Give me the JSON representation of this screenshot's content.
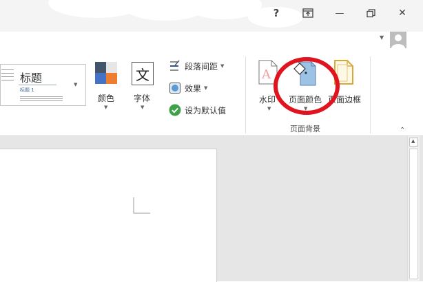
{
  "window": {
    "help_label": "?",
    "ribbon_display_label": "",
    "minimize_label": "—",
    "restore_label": "",
    "close_label": "✕"
  },
  "ribbon": {
    "style_thumbnail": {
      "title": "标题",
      "heading1": "标题 1"
    },
    "colors_label": "颜色",
    "fonts_label": "字体",
    "fonts_glyph": "文",
    "paragraph_spacing_label": "段落间距",
    "effects_label": "效果",
    "set_default_label": "设为默认值",
    "watermark_label": "水印",
    "page_color_label": "页面颜色",
    "page_borders_label": "页面边框",
    "page_background_group_label": "页面背景"
  },
  "colors": {
    "annotation_circle": "#e0141e",
    "accent_blue": "#2b579a",
    "set_default_check": "#3fa14a"
  }
}
